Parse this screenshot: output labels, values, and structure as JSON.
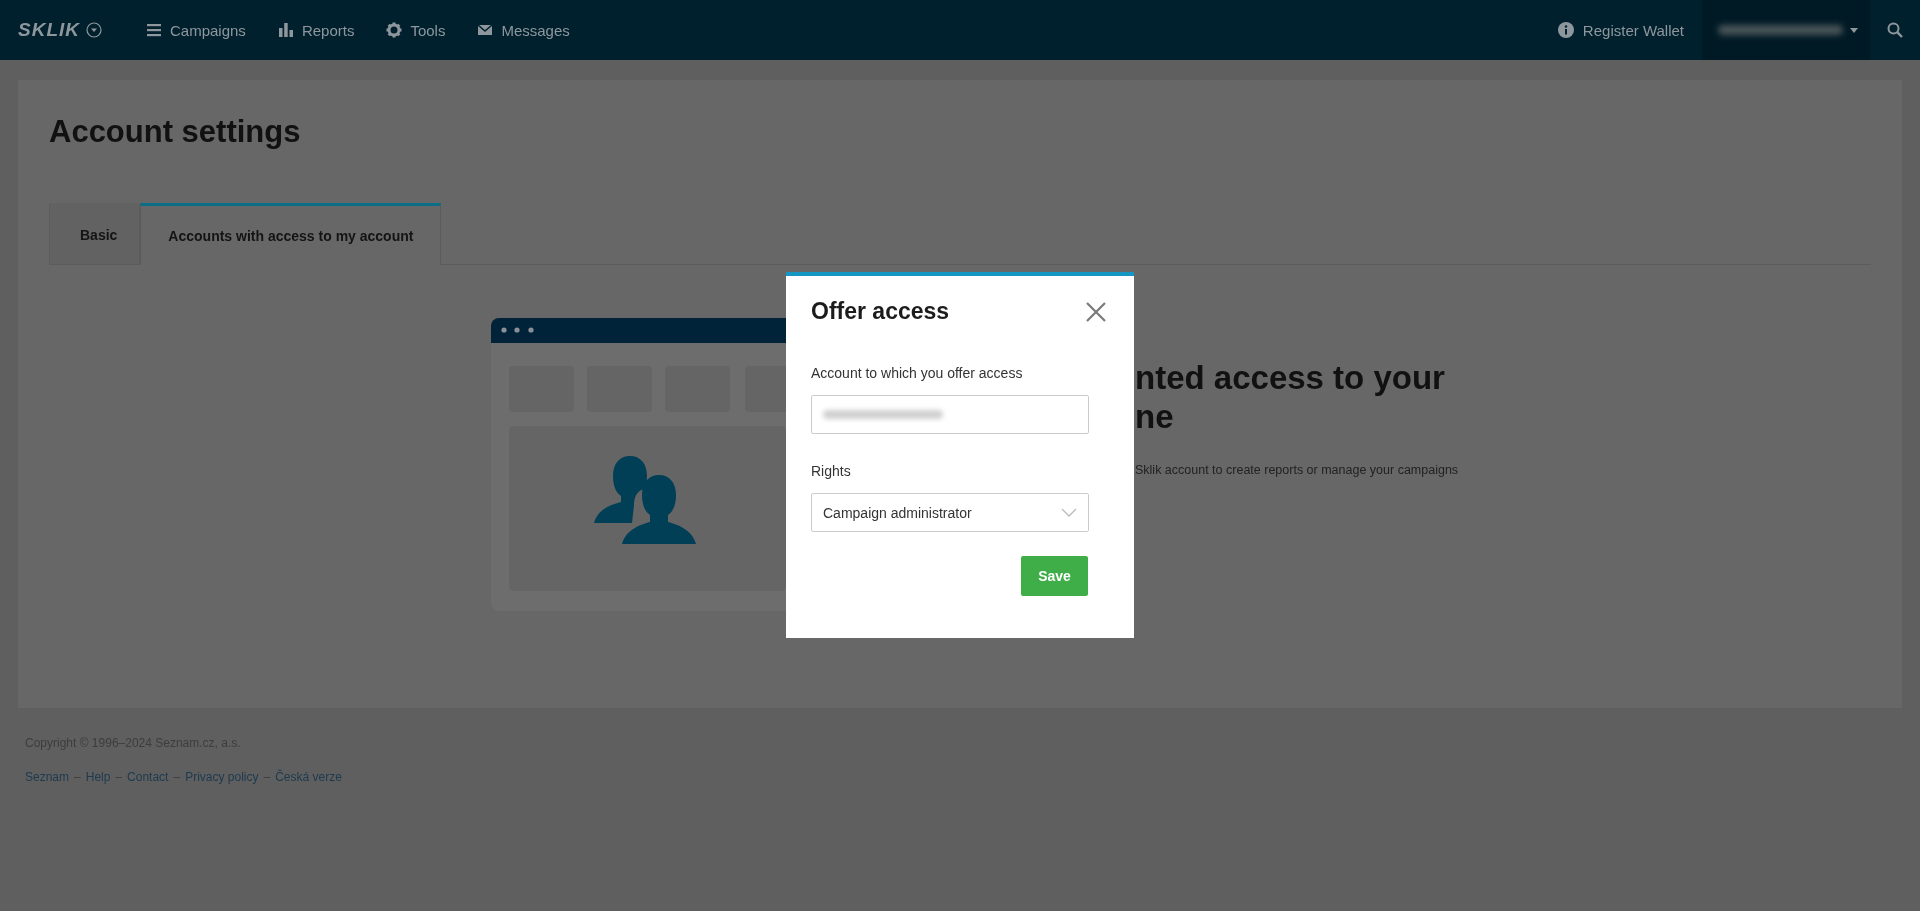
{
  "top_bar": {
    "logo": "SKLIK",
    "nav": [
      {
        "label": "Campaigns",
        "kind": "list"
      },
      {
        "label": "Reports",
        "kind": "chart"
      },
      {
        "label": "Tools",
        "kind": "gear"
      },
      {
        "label": "Messages",
        "kind": "mail"
      }
    ],
    "register_wallet": "Register Wallet"
  },
  "page": {
    "title": "Account settings",
    "tabs": [
      {
        "label": "Basic",
        "selected": false
      },
      {
        "label": "Accounts with access to my account",
        "selected": true
      }
    ],
    "empty_state": {
      "heading_lines": [
        "nted access to your",
        "ne"
      ],
      "text": "Sklik account to create reports or manage your campaigns"
    }
  },
  "modal": {
    "title": "Offer access",
    "fields": [
      {
        "label": "Account to which you offer access",
        "kind": "text"
      },
      {
        "label": "Rights",
        "kind": "select",
        "value": "Campaign administrator"
      }
    ],
    "save": "Save"
  },
  "footer": {
    "copyright": "Copyright © 1996–2024 Seznam.cz, a.s.",
    "separator": "–",
    "links": [
      "Seznam",
      "Help",
      "Contact",
      "Privacy policy",
      "Česká verze"
    ]
  }
}
